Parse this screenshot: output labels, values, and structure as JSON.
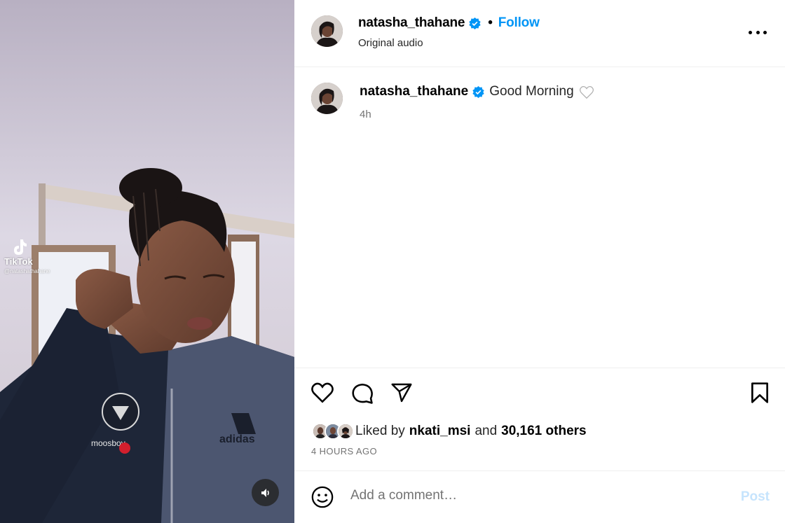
{
  "media": {
    "watermark_brand": "TikTok",
    "watermark_handle": "@natashathahane",
    "sound_icon": "volume-icon"
  },
  "header": {
    "username": "natasha_thahane",
    "separator": "•",
    "follow_label": "Follow",
    "audio": "Original audio",
    "more_icon": "more-options-icon"
  },
  "caption": {
    "username": "natasha_thahane",
    "text": "Good Morning",
    "time": "4h"
  },
  "likes": {
    "prefix": "Liked by",
    "user": "nkati_msi",
    "conj": "and",
    "count": "30,161 others",
    "timestamp": "4 HOURS AGO"
  },
  "comment": {
    "placeholder": "Add a comment…",
    "post_label": "Post"
  },
  "colors": {
    "accent": "#0095f6",
    "verified": "#0095f6",
    "post_disabled": "#c6e4fd"
  }
}
